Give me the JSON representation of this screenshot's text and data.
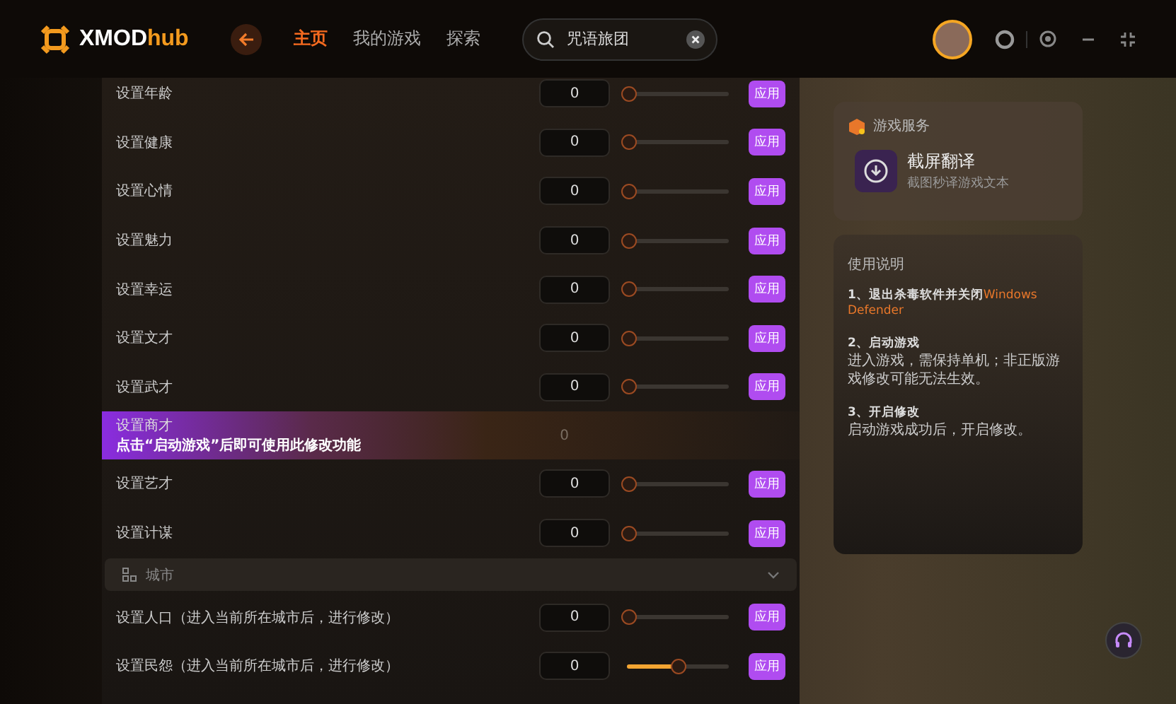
{
  "header": {
    "brand": {
      "name": "XMOD",
      "suffix": "hub"
    },
    "nav": [
      {
        "label": "主页",
        "selected": true
      },
      {
        "label": "我的游戏",
        "selected": false
      },
      {
        "label": "探索",
        "selected": false
      }
    ],
    "search": {
      "value": "咒语旅团"
    }
  },
  "rows": [
    {
      "kind": "slider",
      "label": "设置年龄",
      "value": "0",
      "level": 0,
      "button": "应用"
    },
    {
      "kind": "slider",
      "label": "设置健康",
      "value": "0",
      "level": 0,
      "button": "应用"
    },
    {
      "kind": "slider",
      "label": "设置心情",
      "value": "0",
      "level": 0,
      "button": "应用"
    },
    {
      "kind": "slider",
      "label": "设置魅力",
      "value": "0",
      "level": 0,
      "button": "应用"
    },
    {
      "kind": "slider",
      "label": "设置幸运",
      "value": "0",
      "level": 0,
      "button": "应用"
    },
    {
      "kind": "slider",
      "label": "设置文才",
      "value": "0",
      "level": 0,
      "button": "应用"
    },
    {
      "kind": "slider",
      "label": "设置武才",
      "value": "0",
      "level": 0,
      "button": "应用"
    },
    {
      "kind": "locked",
      "label": "设置商才",
      "message": "点击“启动游戏”后即可使用此修改功能",
      "value": "0"
    },
    {
      "kind": "slider",
      "label": "设置艺才",
      "value": "0",
      "level": 0,
      "button": "应用"
    },
    {
      "kind": "slider",
      "label": "设置计谋",
      "value": "0",
      "level": 0,
      "button": "应用"
    },
    {
      "kind": "section",
      "label": "城市",
      "expanded": true
    },
    {
      "kind": "slider",
      "label": "设置人口（进入当前所在城市后，进行修改）",
      "value": "0",
      "level": 0,
      "button": "应用"
    },
    {
      "kind": "slider",
      "label": "设置民怨（进入当前所在城市后，进行修改）",
      "value": "0",
      "level": 0.5,
      "button": "应用"
    }
  ],
  "services": {
    "title": "游戏服务",
    "items": [
      {
        "name": "截屏翻译",
        "desc": "截图秒译游戏文本"
      }
    ]
  },
  "guide": {
    "title": "使用说明",
    "steps": [
      {
        "title": "1、退出杀毒软件并关闭",
        "highlight": "Windows Defender"
      },
      {
        "title": "2、启动游戏",
        "text": "进入游戏，需保持单机；非正版游戏修改可能无法生效。"
      },
      {
        "title": "3、开启修改",
        "text": "启动游戏成功后，开启修改。"
      }
    ]
  }
}
